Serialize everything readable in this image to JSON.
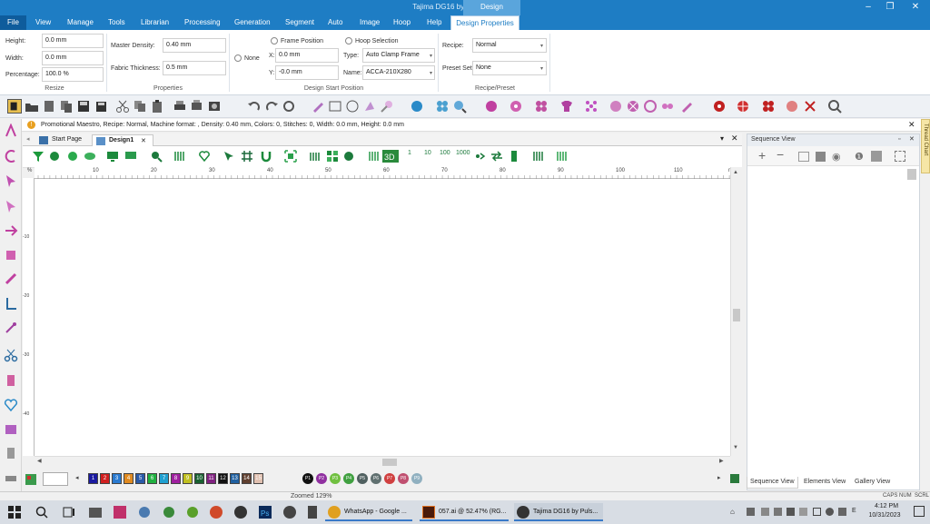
{
  "titlebar": {
    "title": "Tajima DG16 by Pulse - Design1",
    "context_tab": "Design"
  },
  "menu": {
    "file": "File",
    "items": [
      "View",
      "Manage",
      "Tools",
      "Librarian",
      "Processing",
      "Generation",
      "Segment",
      "Auto",
      "Image",
      "Hoop",
      "Help"
    ],
    "active": "Design Properties"
  },
  "ribbon": {
    "resize": {
      "group": "Resize",
      "height_label": "Height:",
      "height_value": "0.0 mm",
      "width_label": "Width:",
      "width_value": "0.0 mm",
      "percentage_label": "Percentage:",
      "percentage_value": "100.0 %"
    },
    "properties": {
      "group": "Properties",
      "master_density_label": "Master Density:",
      "master_density_value": "0.40 mm",
      "fabric_thickness_label": "Fabric Thickness:",
      "fabric_thickness_value": "0.5 mm"
    },
    "start_position": {
      "group": "Design Start Position",
      "none_label": "None",
      "frame_position_label": "Frame Position",
      "hoop_selection_label": "Hoop Selection",
      "x_label": "X:",
      "x_value": "0.0 mm",
      "y_label": "Y:",
      "y_value": "-0.0 mm",
      "type_label": "Type:",
      "type_value": "Auto Clamp Frame",
      "name_label": "Name:",
      "name_value": "ACCA-210X280"
    },
    "recipe": {
      "group": "Recipe/Preset",
      "recipe_label": "Recipe:",
      "recipe_value": "Normal",
      "preset_label": "Preset Set:",
      "preset_value": "None"
    }
  },
  "infobar": {
    "text": "Promotional Maestro, Recipe: Normal, Machine format: , Density: 0.40 mm, Colors: 0, Stitches: 0, Width:  0.0 mm, Height:  0.0 mm"
  },
  "tabs": [
    {
      "label": "Start Page"
    },
    {
      "label": "Design1"
    }
  ],
  "design_toolbar": {
    "numbers": [
      "1",
      "10",
      "100",
      "1000"
    ]
  },
  "ruler": {
    "unit_left": "%",
    "unit_right": "mm",
    "h_ticks": [
      "10",
      "20",
      "30",
      "40",
      "50",
      "60",
      "70",
      "80",
      "90",
      "100",
      "110"
    ],
    "v_ticks": [
      "-10",
      "-20",
      "-30",
      "-40"
    ]
  },
  "colors": {
    "swatches": [
      {
        "n": "1",
        "c": "#1a1aa0"
      },
      {
        "n": "2",
        "c": "#d02020"
      },
      {
        "n": "3",
        "c": "#2a7ad0"
      },
      {
        "n": "4",
        "c": "#e08a20"
      },
      {
        "n": "5",
        "c": "#2a5aa8"
      },
      {
        "n": "6",
        "c": "#20b040"
      },
      {
        "n": "7",
        "c": "#20a0d0"
      },
      {
        "n": "8",
        "c": "#a020a0"
      },
      {
        "n": "9",
        "c": "#c0c020"
      },
      {
        "n": "10",
        "c": "#186030"
      },
      {
        "n": "11",
        "c": "#802080"
      },
      {
        "n": "12",
        "c": "#101010"
      },
      {
        "n": "13",
        "c": "#2060a0"
      },
      {
        "n": "14",
        "c": "#604030"
      },
      {
        "n": "15",
        "c": "#e0c0b0"
      }
    ],
    "palettes": [
      {
        "n": "P1",
        "c": "#111111"
      },
      {
        "n": "P2",
        "c": "#9030a0"
      },
      {
        "n": "P3",
        "c": "#70c040"
      },
      {
        "n": "P4",
        "c": "#40a040"
      },
      {
        "n": "P5",
        "c": "#506060"
      },
      {
        "n": "P6",
        "c": "#607070"
      },
      {
        "n": "P7",
        "c": "#d04040"
      },
      {
        "n": "P8",
        "c": "#c05070"
      },
      {
        "n": "P9",
        "c": "#90b0c0"
      }
    ]
  },
  "sequence": {
    "title": "Sequence View",
    "tabs": [
      "Sequence View",
      "Elements View",
      "Gallery View"
    ]
  },
  "thread_chart": "Thread Chart",
  "status": {
    "zoom": "Zoomed 129%",
    "caps": "CAPS",
    "num": "NUM",
    "scrl": "SCRL"
  },
  "taskbar": {
    "apps": [
      "WhatsApp - Google ...",
      "057.ai @ 52.47% (RG...",
      "Tajima DG16 by Puls..."
    ],
    "lang": "E",
    "time": "4:12 PM",
    "date": "10/31/2023"
  }
}
